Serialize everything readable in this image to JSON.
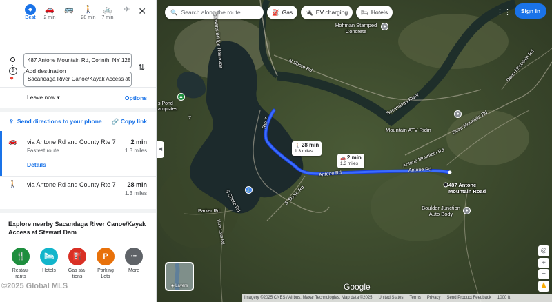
{
  "modes": [
    {
      "icon": "diamond-route-icon",
      "label": "Best",
      "active": true
    },
    {
      "icon": "car-icon",
      "label": "2 min"
    },
    {
      "icon": "bus-icon",
      "label": ""
    },
    {
      "icon": "walk-icon",
      "label": "28 min"
    },
    {
      "icon": "bike-icon",
      "label": "7 min"
    },
    {
      "icon": "flight-icon",
      "label": ""
    }
  ],
  "origin": "487 Antone Mountain Rd, Corinth, NY 128",
  "destination": "Sacandaga River Canoe/Kayak Access at",
  "add_destination": "Add destination",
  "leave_now": "Leave now",
  "options": "Options",
  "send_directions": "Send directions to your phone",
  "copy_link": "Copy link",
  "routes": [
    {
      "title": "via Antone Rd and County Rte 7",
      "time": "2 min",
      "sub": "Fastest route",
      "dist": "1.3 miles",
      "details": "Details",
      "mode": "car-icon"
    },
    {
      "title": "via Antone Rd and County Rte 7",
      "time": "28 min",
      "sub": "",
      "dist": "1.3 miles",
      "mode": "walk-icon"
    }
  ],
  "explore_title": "Explore nearby Sacandaga River Canoe/Kayak Access at Stewart Dam",
  "explore_chips": [
    {
      "label": "Restau-rants",
      "icon": "fork-knife-icon",
      "color": "#1e8e3e",
      "glyph": "🍴"
    },
    {
      "label": "Hotels",
      "icon": "bed-icon",
      "color": "#12b5cb",
      "glyph": "🛏"
    },
    {
      "label": "Gas sta-tions",
      "icon": "gas-pump-icon",
      "color": "#d93025",
      "glyph": "⛽"
    },
    {
      "label": "Parking Lots",
      "icon": "parking-icon",
      "color": "#e8710a",
      "glyph": "P"
    },
    {
      "label": "More",
      "icon": "more-icon",
      "color": "#5f6368",
      "glyph": "•••"
    }
  ],
  "watermark": "©2025 Global MLS",
  "map": {
    "search_placeholder": "Search along the route",
    "chips": [
      {
        "label": "Gas",
        "icon": "gas-pump-icon"
      },
      {
        "label": "EV charging",
        "icon": "ev-plug-icon"
      },
      {
        "label": "Hotels",
        "icon": "bed-icon"
      }
    ],
    "sign_in": "Sign in",
    "labels": {
      "hoffman": "Hoffman Stamped Concrete",
      "stewarts_bridge": "Stewarts Bridge Reservoir",
      "n_shore_rd": "N Shore Rd",
      "sacandaga_river": "Sacandaga River",
      "dean_mountain_rd": "Dean Mountain Rd",
      "mountain_atv": "Mountain ATV Ridin",
      "rte7": "Rte 7",
      "antone_rd_a": "Antone Rd",
      "antone_rd_b": "Antone Rd",
      "antone_mountain_rd": "Antone Mountain Rd",
      "address_pin": "487 Antone Mountain Road",
      "s_shore_rd_a": "S Shore Rd",
      "s_shore_rd_b": "S Shore Rd",
      "parker_rd": "Parker Rd",
      "hunt_lake_rd": "Hunt Lake Rd",
      "boulder_junction": "Boulder Junction Auto Body",
      "campsites": "s Pond\nampsites",
      "seven": "7"
    },
    "walk_callout": {
      "time": "28 min",
      "dist": "1.3 miles"
    },
    "car_callout": {
      "time": "2 min",
      "dist": "1.3 miles"
    },
    "layers": "Layers",
    "google": "Google",
    "footer": [
      "Imagery ©2025 CNES / Airbus, Maxar Technologies, Map data ©2025",
      "United States",
      "Terms",
      "Privacy",
      "Send Product Feedback",
      "1000 ft"
    ]
  }
}
